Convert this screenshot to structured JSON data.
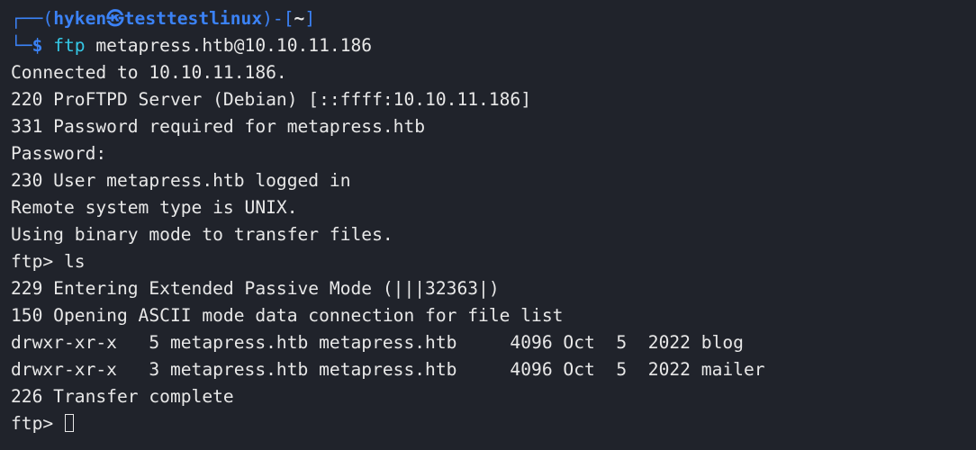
{
  "prompt": {
    "frame_top": "┌──(",
    "user_host": "hyken㉿testtestlinux",
    "frame_mid": ")-[",
    "path": "~",
    "frame_end": "]",
    "frame_bottom": "└─",
    "dollar": "$ ",
    "command": "ftp",
    "arguments": " metapress.htb@10.10.11.186"
  },
  "output": [
    "Connected to 10.10.11.186.",
    "220 ProFTPD Server (Debian) [::ffff:10.10.11.186]",
    "331 Password required for metapress.htb",
    "Password:",
    "230 User metapress.htb logged in",
    "Remote system type is UNIX.",
    "Using binary mode to transfer files.",
    "ftp> ls",
    "229 Entering Extended Passive Mode (|||32363|)",
    "150 Opening ASCII mode data connection for file list",
    "drwxr-xr-x   5 metapress.htb metapress.htb     4096 Oct  5  2022 blog",
    "drwxr-xr-x   3 metapress.htb metapress.htb     4096 Oct  5  2022 mailer",
    "226 Transfer complete"
  ],
  "final_prompt": "ftp> ",
  "colors": {
    "background": "#20232b",
    "text": "#e8e8e8",
    "prompt_blue": "#3b82f6",
    "command_cyan": "#35c8e6"
  }
}
